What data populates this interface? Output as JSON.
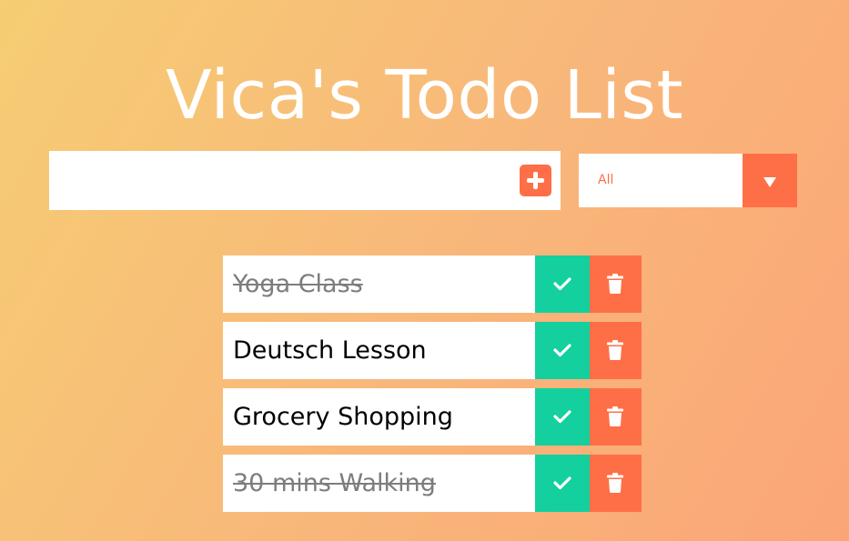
{
  "header": {
    "title": "Vica's Todo List"
  },
  "form": {
    "input_value": "",
    "add_icon": "plus-square-icon",
    "filter": {
      "selected": "All",
      "arrow_icon": "caret-down-icon"
    }
  },
  "todos": [
    {
      "text": "Yoga Class",
      "completed": true
    },
    {
      "text": "Deutsch Lesson",
      "completed": false
    },
    {
      "text": "Grocery Shopping",
      "completed": false
    },
    {
      "text": "30 mins Walking",
      "completed": true
    }
  ],
  "icons": {
    "complete": "check-icon",
    "delete": "trash-icon"
  },
  "colors": {
    "accent": "#ff6f47",
    "complete": "#13d09e",
    "background_start": "#f6cd73",
    "background_end": "#fba577"
  }
}
